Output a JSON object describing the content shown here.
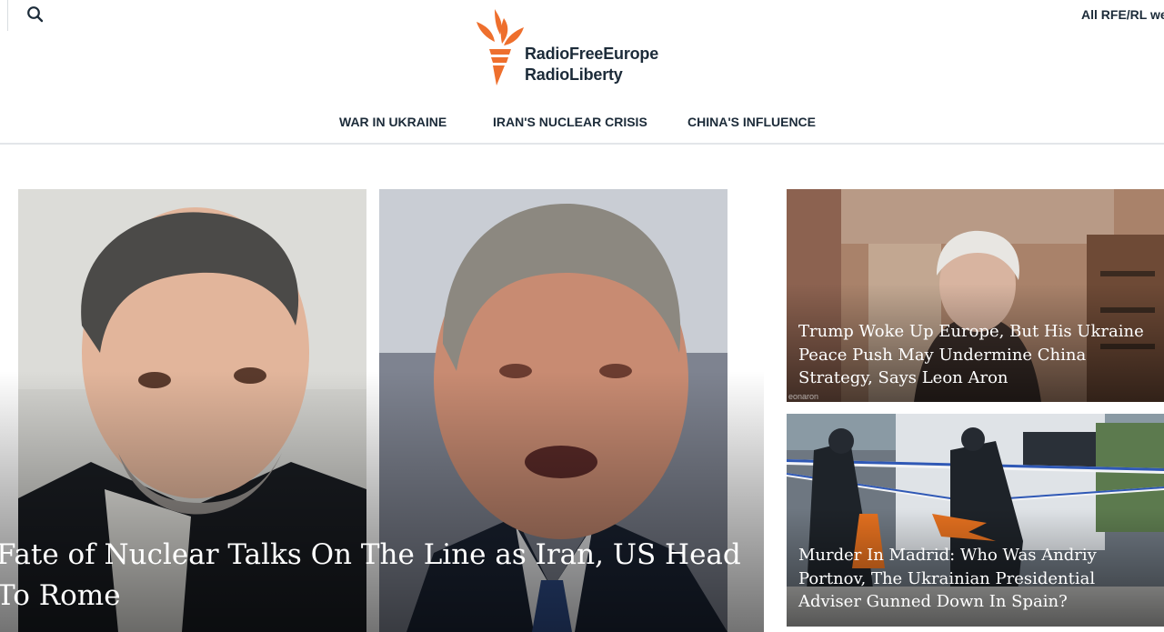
{
  "header": {
    "search_icon": "search-icon",
    "all_sites_label": "All RFE/RL we",
    "logo": {
      "line1": "RadioFreeEurope",
      "line2": "RadioLiberty",
      "accent": "#ee6f2d"
    }
  },
  "nav": {
    "items": [
      {
        "label": "WAR IN UKRAINE"
      },
      {
        "label": "IRAN'S NUCLEAR CRISIS"
      },
      {
        "label": "CHINA'S INFLUENCE"
      }
    ]
  },
  "main_story": {
    "headline": "Fate of Nuclear Talks On The Line as Iran, US Head To Rome"
  },
  "side_stories": [
    {
      "headline": "Trump Woke Up Europe, But His Ukraine Peace Push May Undermine China Strategy, Says Leon Aron",
      "watermark": "eonaron"
    },
    {
      "headline": "Murder In Madrid: Who Was Andriy Portnov, The Ukrainian Presidential Adviser Gunned Down In Spain?"
    }
  ]
}
